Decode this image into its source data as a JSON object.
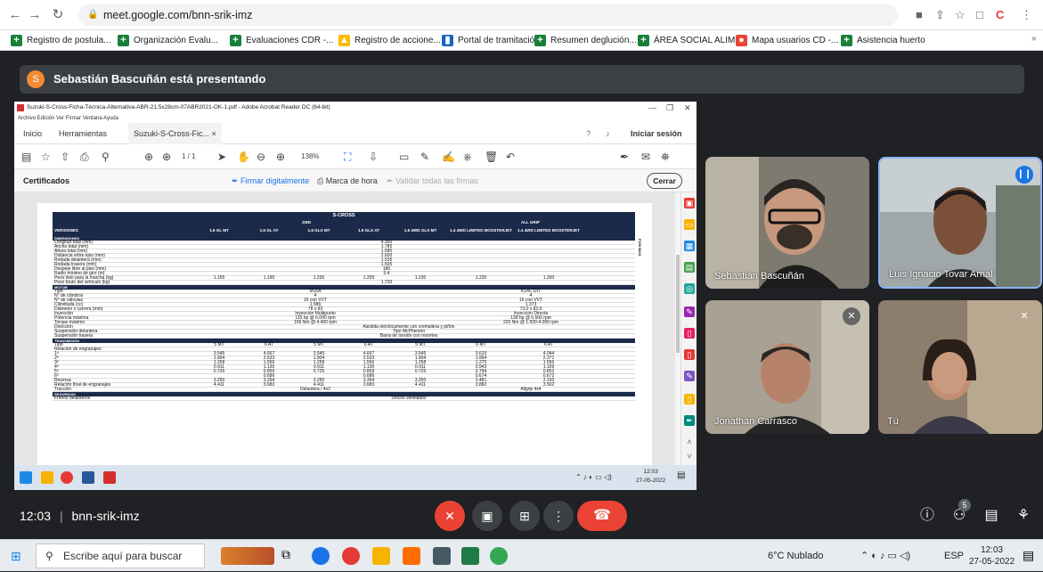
{
  "browser": {
    "url": "meet.google.com/bnn-srik-imz"
  },
  "bookmarks": [
    {
      "label": "Registro de postula..."
    },
    {
      "label": "Organización Evalu..."
    },
    {
      "label": "Evaluaciones CDR -..."
    },
    {
      "label": "Registro de accione..."
    },
    {
      "label": "Portal de tramitació..."
    },
    {
      "label": "Resumen deglución..."
    },
    {
      "label": "ÁREA SOCIAL ALIM..."
    },
    {
      "label": "Mapa usuarios CD -..."
    },
    {
      "label": "Asistencia huerto"
    }
  ],
  "presenter": {
    "initial": "S",
    "text": "Sebastián Bascuñán está presentando"
  },
  "acrobat": {
    "title": "Suzuki-S-Cross-Ficha-Técnica-Alternativa-ABR-21.5x28cm-07ABR2021-OK-1.pdf - Adobe Acrobat Reader DC (64-bit)",
    "menu": "Archivo  Edición  Ver  Firmar  Ventana  Ayuda",
    "tabs": {
      "inicio": "Inicio",
      "herramientas": "Herramientas",
      "doc": "Suzuki-S-Cross-Fic... ×"
    },
    "signin": "Iniciar sesión",
    "page": "1 / 1",
    "zoom": "138%",
    "cert": {
      "label": "Certificados",
      "sign": "Firmar digitalmente",
      "stamp": "Marca de hora",
      "validate": "Validar todas las firmas",
      "close": "Cerrar"
    }
  },
  "sheet": {
    "title": "S-CROSS",
    "groups": {
      "g1": "2WD",
      "g2": "ALL GRIP"
    },
    "columns": [
      "VERSIONES",
      "1.6 GL MT",
      "1.6 GL AT",
      "1.6 GLX MT",
      "1.6 GLX AT",
      "1.6 4WD GLX MT",
      "1.4 4WD LIMITED BOOSTERJET",
      "1.4 4WD LIMITED BOOSTERJET AT"
    ],
    "sections": {
      "dim": "DIMENSIONES",
      "motor": "MOTOR",
      "trans": "TRANSMISIÓN",
      "seg": "SEGURIDAD"
    },
    "dims": [
      {
        "l": "Longitud total (mm)",
        "v": "4.300"
      },
      {
        "l": "Ancho total (mm)",
        "v": "1.785"
      },
      {
        "l": "Altura total (mm)",
        "v": "1.585"
      },
      {
        "l": "Distancia entre ejes (mm)",
        "v": "2.600"
      },
      {
        "l": "Rodada delantera (mm)",
        "v": "1.535"
      },
      {
        "l": "Rodada trasera (mm)",
        "v": "1.505"
      },
      {
        "l": "Despeje libre al piso (mm)",
        "v": "180"
      },
      {
        "l": "Radio mínimo de giro (m)",
        "v": "5.4"
      }
    ],
    "weight": {
      "l": "Peso listo para la marcha (kg)",
      "vals": [
        "1.165",
        "1.190",
        "1.230",
        "1.255",
        "1.230",
        "1.235",
        "1.260"
      ]
    },
    "gross": {
      "l": "Peso bruto del vehículo (kg)",
      "v": "1.720"
    },
    "motor": [
      {
        "l": "Tipo",
        "a": "M16A",
        "b": "K14C DIT"
      },
      {
        "l": "N° de cilindros",
        "a": "4",
        "b": "4"
      },
      {
        "l": "N° de válvulas",
        "a": "16 con VVT",
        "b": "16 con VVT"
      },
      {
        "l": "Cilindrada (cc)",
        "a": "1.586",
        "b": "1.373"
      },
      {
        "l": "Diámetro x carrera (mm)",
        "a": "78 x 83",
        "b": "73,0 x 82,0"
      },
      {
        "l": "Inyección",
        "a": "Inyección Multipunto",
        "b": "Inyección Directa"
      },
      {
        "l": "Potencia máxima",
        "a": "115 hp @ 6.000 rpm",
        "b": "138 hp @ 5.500 rpm"
      },
      {
        "l": "Torque máximo",
        "a": "156 Nm @ 4.400 rpm",
        "b": "220 Nm @ 1.500-4.000 rpm"
      }
    ],
    "misc": [
      {
        "l": "Dirección",
        "v": "Asistida eléctricamente con cremallera y piñón"
      },
      {
        "l": "Suspensión delantera",
        "v": "Tipo McPherson"
      },
      {
        "l": "Suspensión trasera",
        "v": "Barra de torsión con resortes"
      }
    ],
    "trans": [
      {
        "l": "Tipo",
        "vals": [
          "5 MT",
          "6 AT",
          "5 MT",
          "6 AT",
          "5 MT",
          "6 MT",
          "6 AT"
        ]
      },
      {
        "l": "Relación de engranajes:",
        "vals": [
          "",
          "",
          "",
          "",
          "",
          "",
          ""
        ]
      },
      {
        "l": "1ª",
        "vals": [
          "3.545",
          "4.667",
          "3.545",
          "4.667",
          "3.545",
          "3.615",
          "4.044"
        ]
      },
      {
        "l": "2ª",
        "vals": [
          "1.904",
          "2.533",
          "1.904",
          "2.533",
          "1.904",
          "1.954",
          "2.371"
        ]
      },
      {
        "l": "3ª",
        "vals": [
          "1.258",
          "1.556",
          "1.258",
          "1.556",
          "1.258",
          "1.275",
          "1.556"
        ]
      },
      {
        "l": "4ª",
        "vals": [
          "0.911",
          "1.135",
          "0.911",
          "1.135",
          "0.911",
          "0.943",
          "1.159"
        ]
      },
      {
        "l": "5ª",
        "vals": [
          "0.725",
          "0.859",
          "0.725",
          "0.859",
          "0.725",
          "0.794",
          "0.852"
        ]
      },
      {
        "l": "6ª",
        "vals": [
          "",
          "0.686",
          "",
          "0.686",
          "",
          "0.674",
          "0.672"
        ]
      },
      {
        "l": "Reversa",
        "vals": [
          "3.250",
          "3.394",
          "3.250",
          "3.394",
          "3.250",
          "3.481",
          "3.193"
        ]
      },
      {
        "l": "Relación final de engranajes",
        "vals": [
          "4.411",
          "3.683",
          "4.411",
          "3.683",
          "4.411",
          "3.882",
          "3.502"
        ]
      }
    ],
    "traction": {
      "l": "Tracción",
      "a": "Delantera / 4x2",
      "b": "Allgrip 4x4"
    },
    "brakes": {
      "l": "Frenos delanteros",
      "v": "Discos ventilados"
    },
    "side_code": "FCM 06/21"
  },
  "inner_clock": {
    "time": "12:03",
    "date": "27-05-2022"
  },
  "participants": [
    {
      "name": "Sebastián Bascuñán"
    },
    {
      "name": "Luis Ignacio Tovar Arnal"
    },
    {
      "name": "Jonathan Carrasco"
    },
    {
      "name": "Tú"
    }
  ],
  "meet_bar": {
    "time": "12:03",
    "separator": "|",
    "code": "bnn-srik-imz",
    "people_count": "5"
  },
  "taskbar": {
    "search": "Escribe aquí para buscar",
    "weather": "6°C Nublado",
    "lang": "ESP",
    "time": "12:03",
    "date": "27-05-2022"
  },
  "colors": {
    "meet_bg": "#202124",
    "hangup": "#ea4335",
    "sheet_header": "#1b2a4a",
    "accent": "#1a73e8"
  }
}
